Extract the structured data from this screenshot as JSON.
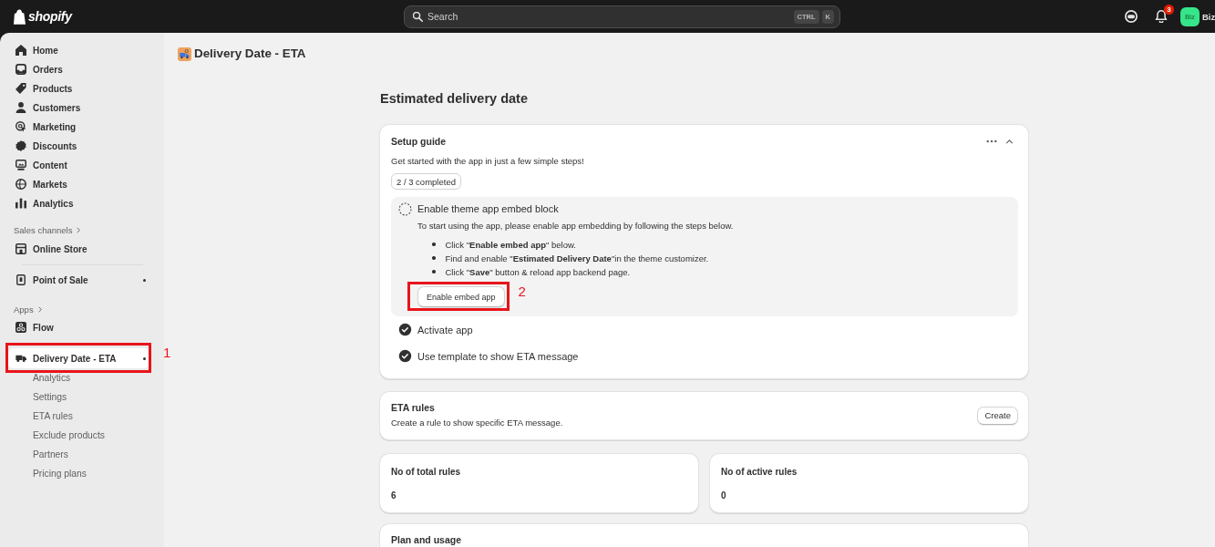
{
  "top_bar": {
    "logo_text": "shopify",
    "search": {
      "placeholder": "Search",
      "shortcut": [
        "CTRL",
        "K"
      ]
    },
    "notification_count": "3",
    "account": {
      "initials": "Biz",
      "name": "Biz"
    }
  },
  "sidebar": {
    "items": [
      {
        "label": "Home",
        "selected": false
      },
      {
        "label": "Orders",
        "selected": false
      },
      {
        "label": "Products",
        "selected": false
      },
      {
        "label": "Customers",
        "selected": false
      },
      {
        "label": "Marketing",
        "selected": false
      },
      {
        "label": "Discounts",
        "selected": false
      },
      {
        "label": "Content",
        "selected": false
      },
      {
        "label": "Markets",
        "selected": false
      },
      {
        "label": "Analytics",
        "selected": false
      }
    ],
    "sections": [
      {
        "title": "Sales channels",
        "items": [
          {
            "label": "Online Store",
            "selected": false,
            "indicator": false
          },
          {
            "label": "Point of Sale",
            "selected": false,
            "indicator": true
          }
        ]
      },
      {
        "title": "Apps",
        "items": [
          {
            "label": "Flow",
            "selected": false,
            "indicator": false
          }
        ]
      }
    ],
    "current_app": {
      "label": "Delivery Date - ETA",
      "selected": true,
      "indicator": true,
      "annotation": "1",
      "children": [
        {
          "label": "Analytics",
          "selected": false
        },
        {
          "label": "Settings",
          "selected": false
        },
        {
          "label": "ETA rules",
          "selected": false
        },
        {
          "label": "Exclude products",
          "selected": false
        },
        {
          "label": "Partners",
          "selected": false
        },
        {
          "label": "Pricing plans",
          "selected": false
        }
      ]
    }
  },
  "page": {
    "title": "Delivery Date - ETA",
    "heading": "Estimated delivery date"
  },
  "setup_guide": {
    "title": "Setup guide",
    "expanded": true,
    "subtitle": "Get started with the app in just a few simple steps!",
    "progress": "2 / 3 completed",
    "steps": [
      {
        "title": "Enable theme app embed block",
        "completed": false,
        "expanded": true,
        "description": "To start using the app, please enable app embedding by following the steps below.",
        "instructions": [
          "Click \"**Enable embed app**\" below.",
          "Find and enable \"**Estimated Delivery Date**\"in the theme customizer.",
          "Click \"**Save**\" button & reload app backend page."
        ],
        "button": {
          "label": "Enable embed app",
          "annotation": "2"
        }
      },
      {
        "title": "Activate app",
        "completed": true,
        "expanded": false
      },
      {
        "title": "Use template to show ETA message",
        "completed": true,
        "expanded": false
      }
    ]
  },
  "eta_rules": {
    "title": "ETA rules",
    "description": "Create a rule to show specific ETA message.",
    "button": "Create"
  },
  "stats": [
    {
      "label": "No of total rules",
      "value": "6"
    },
    {
      "label": "No of active rules",
      "value": "0"
    }
  ],
  "plan_usage": {
    "title": "Plan and usage"
  }
}
